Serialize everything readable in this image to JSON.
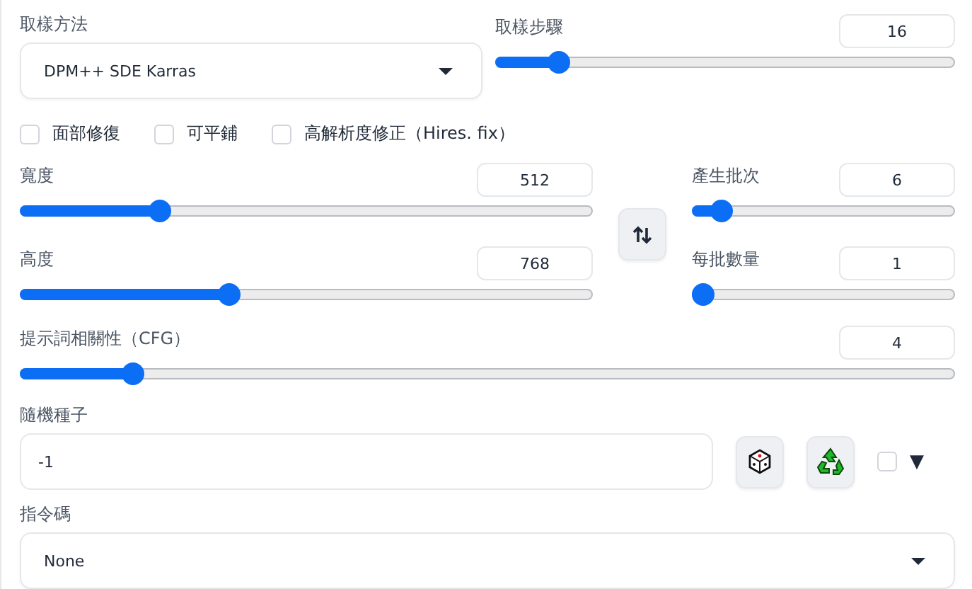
{
  "sampler": {
    "label": "取樣方法",
    "value": "DPM++ SDE Karras"
  },
  "steps": {
    "label": "取樣步驟",
    "value": "16",
    "level": 0.12
  },
  "options": [
    {
      "label": "面部修復",
      "checked": false
    },
    {
      "label": "可平鋪",
      "checked": false
    },
    {
      "label": "高解析度修正（Hires. fix）",
      "checked": false
    }
  ],
  "width": {
    "label": "寬度",
    "value": "512",
    "level": 0.235
  },
  "height": {
    "label": "高度",
    "value": "768",
    "level": 0.36
  },
  "batch_count": {
    "label": "產生批次",
    "value": "6",
    "level": 0.075
  },
  "batch_size": {
    "label": "每批數量",
    "value": "1",
    "level": 0
  },
  "cfg": {
    "label": "提示詞相關性（CFG）",
    "value": "4",
    "level": 0.112
  },
  "seed": {
    "label": "隨機種子",
    "value": "-1",
    "extra_checked": false,
    "toggle": "▼"
  },
  "script": {
    "label": "指令碼",
    "value": "None"
  }
}
